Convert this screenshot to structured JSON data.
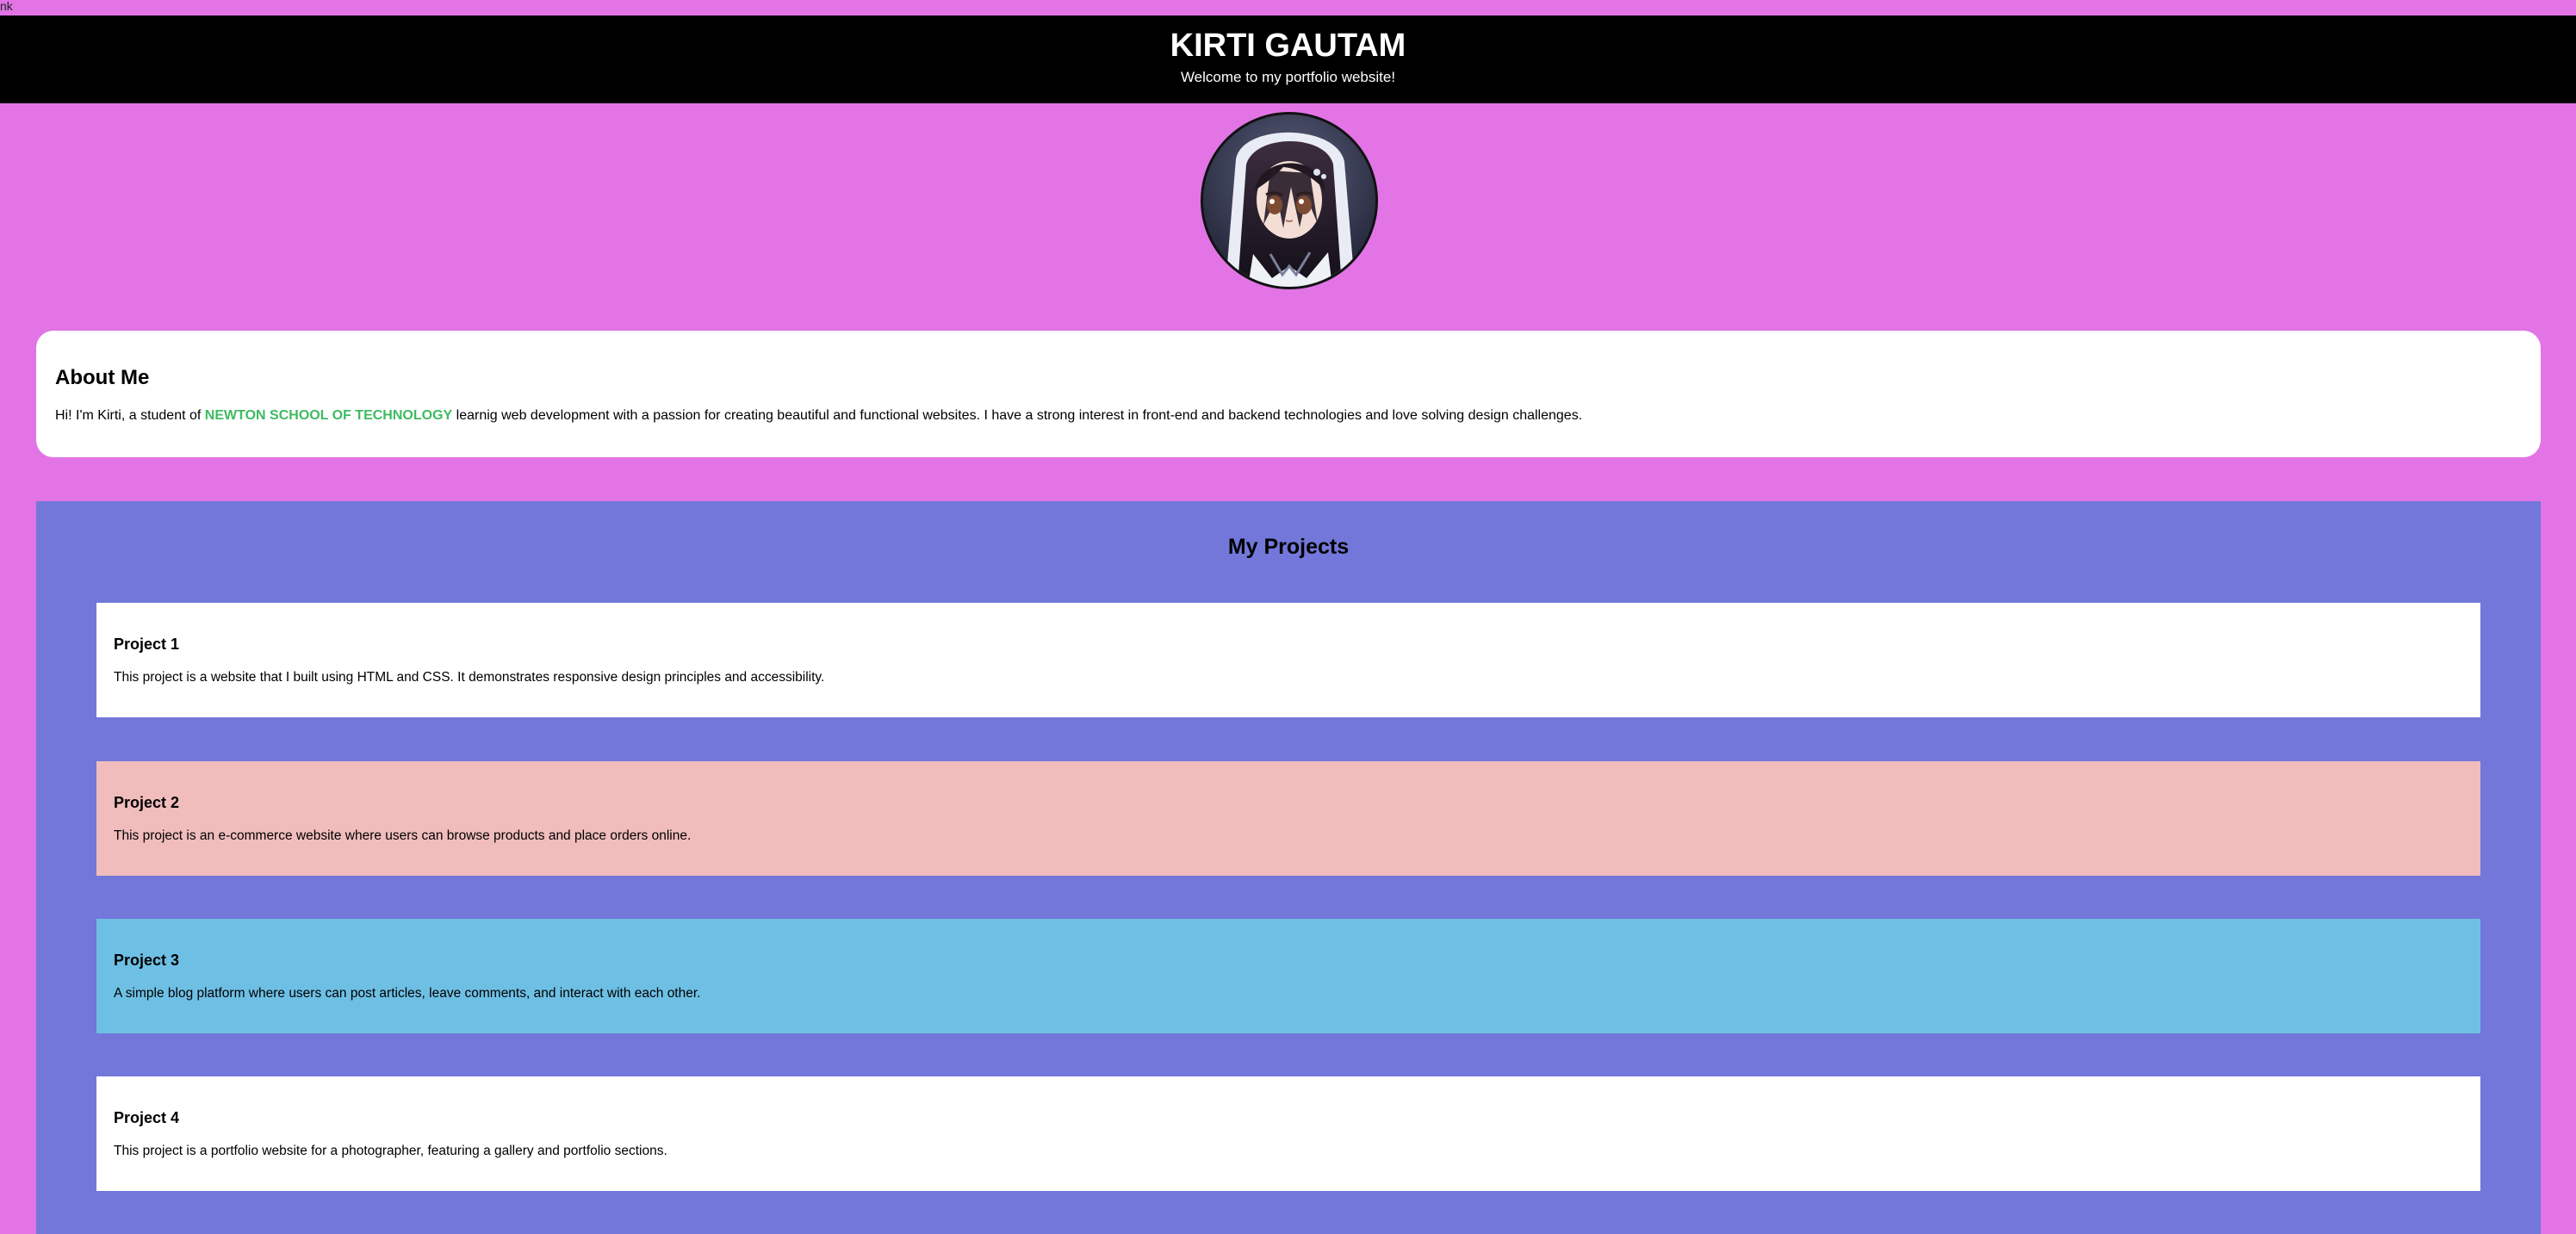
{
  "page": {
    "corner_text": "nk",
    "background_color": "#e274e6"
  },
  "header": {
    "title": "KIRTI GAUTAM",
    "subtitle": "Welcome to my portfolio website!"
  },
  "about": {
    "heading": "About Me",
    "text_before": "Hi! I'm Kirti, a student of ",
    "school": "NEWTON SCHOOL OF TECHNOLOGY",
    "text_after": " learnig web development with a passion for creating beautiful and functional websites. I have a strong interest in front-end and backend technologies and love solving design challenges.",
    "school_color": "#3fba62"
  },
  "projects": {
    "heading": "My Projects",
    "background_color": "#7277d9",
    "items": [
      {
        "title": "Project 1",
        "description": "This project is a website that I built using HTML and CSS. It demonstrates responsive design principles and accessibility.",
        "color": "#ffffff"
      },
      {
        "title": "Project 2",
        "description": "This project is an e-commerce website where users can browse products and place orders online.",
        "color": "#f0bcbc"
      },
      {
        "title": "Project 3",
        "description": "A simple blog platform where users can post articles, leave comments, and interact with each other.",
        "color": "#6ebfe4"
      },
      {
        "title": "Project 4",
        "description": "This project is a portfolio website for a photographer, featuring a gallery and portfolio sections.",
        "color": "#ffffff"
      }
    ]
  },
  "icons": {
    "avatar": "anime-girl-avatar-image"
  }
}
